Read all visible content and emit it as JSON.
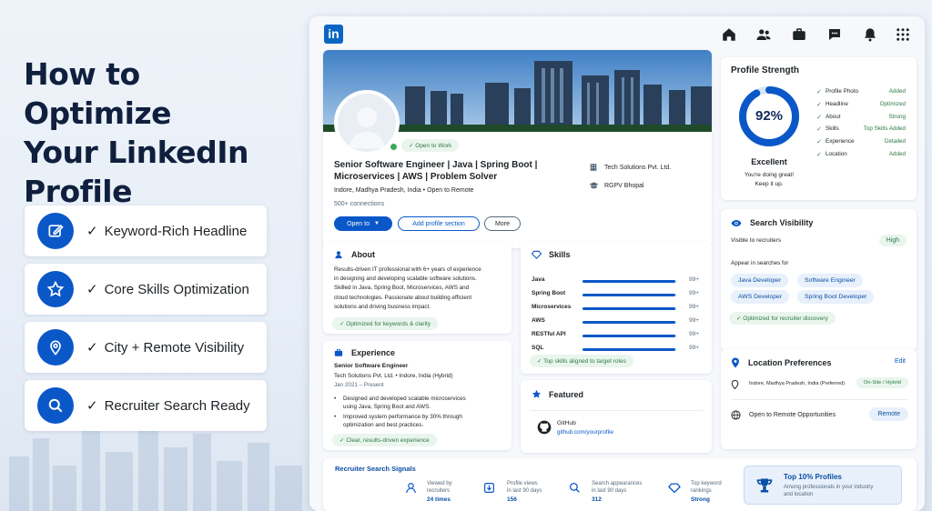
{
  "hero": {
    "title_line1": "How to Optimize",
    "title_line2": "Your LinkedIn",
    "title_line3": "Profile",
    "features": [
      {
        "icon": "edit-icon",
        "check": "✓",
        "label": "Keyword-Rich Headline"
      },
      {
        "icon": "star-icon",
        "check": "✓",
        "label": "Core Skills Optimization"
      },
      {
        "icon": "location-pin-icon",
        "check": "✓",
        "label": "City + Remote Visibility"
      },
      {
        "icon": "search-icon",
        "check": "✓",
        "label": "Recruiter Search Ready"
      }
    ]
  },
  "nav": {
    "logo": "in",
    "icons": [
      "home-icon",
      "network-icon",
      "jobs-icon",
      "messaging-icon",
      "notifications-icon",
      "apps-grid-icon"
    ]
  },
  "profile": {
    "open_badge": "Open to Work",
    "headline_line1": "Senior Software Engineer | Java | Spring Boot |",
    "headline_line2": "Microservices | AWS | Problem Solver",
    "location": "Indore, Madhya Pradesh, India  •  Open to Remote",
    "connections": "500+ connections",
    "company": "Tech Solutions Pvt. Ltd.",
    "school": "RGPV Bhopal",
    "btn_open": "Open to",
    "btn_add": "Add profile section",
    "btn_more": "More"
  },
  "about": {
    "title": "About",
    "text_lines": [
      "Results-driven IT professional with 6+ years of experience",
      "in designing and developing scalable software solutions.",
      "Skilled in Java, Spring Boot, Microservices, AWS and",
      "cloud technologies. Passionate about building efficient",
      "solutions and driving business impact."
    ],
    "badge": "Optimized for keywords & clarity"
  },
  "skills": {
    "title": "Skills",
    "items": [
      {
        "name": "Java",
        "level": 0.98,
        "value": "99+"
      },
      {
        "name": "Spring Boot",
        "level": 0.98,
        "value": "99+"
      },
      {
        "name": "Microservices",
        "level": 0.98,
        "value": "99+"
      },
      {
        "name": "AWS",
        "level": 0.98,
        "value": "99+"
      },
      {
        "name": "RESTful API",
        "level": 0.98,
        "value": "99+"
      },
      {
        "name": "SQL",
        "level": 0.98,
        "value": "99+"
      }
    ],
    "badge": "Top skills aligned to target roles"
  },
  "experience": {
    "title": "Experience",
    "role": "Senior Software Engineer",
    "company": "Tech Solutions Pvt. Ltd.  •  Indore, India (Hybrid)",
    "dates": "Jan 2021 – Present",
    "bullets": [
      [
        "Designed and developed scalable microservices",
        "using Java, Spring Boot and AWS."
      ],
      [
        "Improved system performance by 30% through",
        "optimization and best practices."
      ]
    ],
    "badge": "Clear, results-driven experience"
  },
  "featured": {
    "title": "Featured",
    "item_title": "GitHub",
    "item_link": "github.com/yourprofile"
  },
  "strength": {
    "title": "Profile Strength",
    "percent": "92%",
    "value": 0.92,
    "rating": "Excellent",
    "sub1": "You're doing great!",
    "sub2": "Keep it up.",
    "rows": [
      {
        "k": "Profile Photo",
        "v": "Added"
      },
      {
        "k": "Headline",
        "v": "Optimized"
      },
      {
        "k": "About",
        "v": "Strong"
      },
      {
        "k": "Skills",
        "v": "Top Skills Added"
      },
      {
        "k": "Experience",
        "v": "Detailed"
      },
      {
        "k": "Location",
        "v": "Added"
      }
    ]
  },
  "visibility": {
    "title": "Search Visibility",
    "sub": "Visible to recruiters",
    "level": "High",
    "appear": "Appear in searches for",
    "tags": [
      "Java Developer",
      "Software Engineer",
      "AWS Developer",
      "Spring Boot Developer"
    ],
    "badge": "Optimized for recruiter discovery"
  },
  "location_pref": {
    "title": "Location Preferences",
    "edit": "Edit",
    "place": "Indore, Madhya Pradesh, India (Preferred)",
    "mode": "On-Site / Hybrid",
    "remote_label": "Open to Remote Opportunities",
    "remote_value": "Remote"
  },
  "signals": {
    "title": "Recruiter Search Signals",
    "stats": [
      {
        "icon": "user-icon",
        "l1": "Viewed by",
        "l1b": "recruiters",
        "val": "24 times"
      },
      {
        "icon": "profile-views-icon",
        "l1": "Profile views",
        "l1b": "in last 90 days",
        "val": "156"
      },
      {
        "icon": "search-icon",
        "l1": "Search appearances",
        "l1b": "in last 90 days",
        "val": "312"
      },
      {
        "icon": "diamond-icon",
        "l1": "Top keyword",
        "l1b": "rankings",
        "val": "Strong"
      }
    ],
    "top_title": "Top 10% Profiles",
    "top_sub1": "Among professionals in your industry",
    "top_sub2": "and location"
  },
  "colors": {
    "brand": "#0a66c2",
    "accent": "#0a58c8",
    "success": "#2d7a46"
  }
}
